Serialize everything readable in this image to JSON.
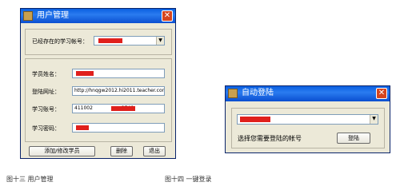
{
  "dialog1": {
    "title": "用户管理",
    "existing_label": "已经存在的学习帐号：",
    "name_label": "学员姓名：",
    "url_label": "登陆网址：",
    "url_value": "http://hnqgw2012.hi2011.teacher.cor",
    "account_label": "学习账号：",
    "account_value": "411002　　　　　　2548",
    "password_label": "学习密码：",
    "add_button": "添加/修改学员",
    "delete_button": "删除",
    "exit_button": "退出",
    "close_glyph": "✕"
  },
  "dialog2": {
    "title": "自动登陆",
    "prompt": "选择您需要登陆的帐号",
    "login_button": "登陆",
    "close_glyph": "✕"
  },
  "captions": {
    "fig13": "图十三  用户管理",
    "fig14": "图十四  一键登录"
  }
}
